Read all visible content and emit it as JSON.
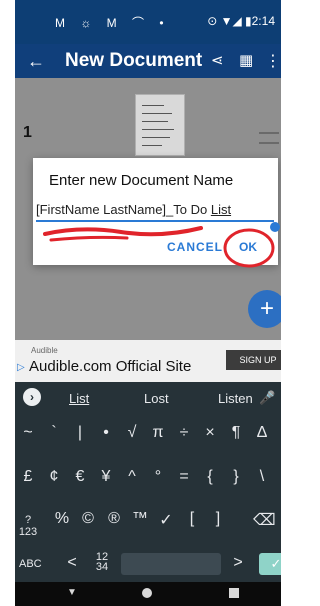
{
  "statusbar": {
    "left_icons": "M ☼ M ⌒ •",
    "right_icons": "⊙ ▼◢ ▮2:14"
  },
  "appbar": {
    "title": "New Document",
    "back_icon": "←",
    "share_icon": "⋖",
    "print_icon": "▦",
    "more_icon": "⋮"
  },
  "list": {
    "row_number": "1"
  },
  "dialog": {
    "title": "Enter new Document Name",
    "value_main": "[FirstName LastName]_To Do ",
    "value_underlined": "List",
    "cancel_label": "CANCEL",
    "ok_label": "OK"
  },
  "fab": {
    "label": "+"
  },
  "ad": {
    "small": "Audible",
    "headline": "Audible.com Official Site",
    "cta": "SIGN UP",
    "arrow": "▷"
  },
  "keyboard": {
    "suggestions": [
      "List",
      "Lost",
      "Listen"
    ],
    "row1": [
      "~",
      "`",
      "|",
      "•",
      "√",
      "π",
      "÷",
      "×",
      "¶",
      "∆"
    ],
    "row2": [
      "£",
      "¢",
      "€",
      "¥",
      "^",
      "°",
      "=",
      "{",
      "}",
      "\\"
    ],
    "row3": [
      "?123",
      "%",
      "©",
      "®",
      "™",
      "✓",
      "[",
      "]",
      "⌫"
    ],
    "row4": [
      "ABC",
      "<",
      "12\n34",
      ">",
      "✓"
    ]
  },
  "navbar": {
    "back": "▼"
  }
}
